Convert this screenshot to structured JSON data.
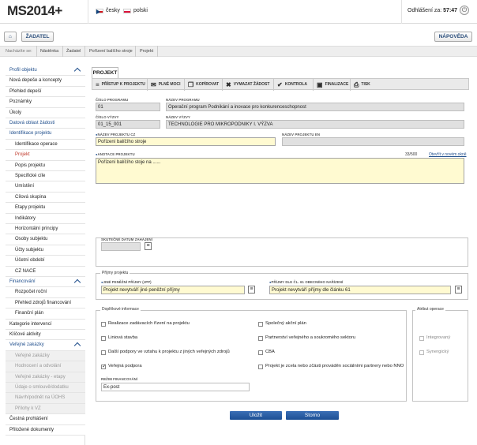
{
  "header": {
    "logo_main": "MS2014",
    "logo_plus": "+",
    "languages": [
      {
        "label": "česky",
        "flag": "cz"
      },
      {
        "label": "polski",
        "flag": "pl"
      }
    ],
    "logout_label": "Odhlášení za:",
    "logout_time": "57:47"
  },
  "nav": {
    "home_icon": "home-icon",
    "zadatel_label": "ŽADATEL",
    "napoveda_label": "NÁPOVĚDA"
  },
  "breadcrumb": {
    "prefix": "Nacházíte se:",
    "items": [
      "Nástěnka",
      "Žadatel",
      "Pořízení balíčho stroje",
      "Projekt"
    ]
  },
  "sidebar": {
    "items": [
      {
        "label": "Profil objektu",
        "type": "head"
      },
      {
        "label": "Nová depeše a koncepty",
        "type": "item"
      },
      {
        "label": "Přehled depeší",
        "type": "item"
      },
      {
        "label": "Poznámky",
        "type": "item"
      },
      {
        "label": "Úkoly",
        "type": "item"
      },
      {
        "label": "Datová oblast žádosti",
        "type": "head"
      },
      {
        "label": "Identifikace projektu",
        "type": "head"
      },
      {
        "label": "Identifikace operace",
        "type": "sub"
      },
      {
        "label": "Projekt",
        "type": "active"
      },
      {
        "label": "Popis projektu",
        "type": "sub"
      },
      {
        "label": "Specifické cíle",
        "type": "sub"
      },
      {
        "label": "Umístění",
        "type": "sub"
      },
      {
        "label": "Cílová skupina",
        "type": "sub"
      },
      {
        "label": "Etapy projektu",
        "type": "sub"
      },
      {
        "label": "Indikátory",
        "type": "sub"
      },
      {
        "label": "Horizontální principy",
        "type": "sub"
      },
      {
        "label": "Osoby subjektu",
        "type": "sub"
      },
      {
        "label": "Účty subjektu",
        "type": "sub"
      },
      {
        "label": "Účetní období",
        "type": "sub"
      },
      {
        "label": "CZ NACE",
        "type": "sub"
      },
      {
        "label": "Financování",
        "type": "head"
      },
      {
        "label": "Rozpočet roční",
        "type": "sub"
      },
      {
        "label": "Přehled zdrojů financování",
        "type": "sub"
      },
      {
        "label": "Finanční plán",
        "type": "sub"
      },
      {
        "label": "Kategorie intervencí",
        "type": "item"
      },
      {
        "label": "Klíčové aktivity",
        "type": "item"
      },
      {
        "label": "Veřejné zakázky",
        "type": "head"
      },
      {
        "label": "Veřejné zakázky",
        "type": "dis"
      },
      {
        "label": "Hodnocení a odvolání",
        "type": "dis"
      },
      {
        "label": "Veřejné zakázky - etapy",
        "type": "dis"
      },
      {
        "label": "Údaje o smlouvě/dodatku",
        "type": "dis"
      },
      {
        "label": "Návrh/podnět na ÚOHS",
        "type": "dis"
      },
      {
        "label": "Přílohy k VZ",
        "type": "dis"
      },
      {
        "label": "Čestná prohlášení",
        "type": "item"
      },
      {
        "label": "Přiložené dokumenty",
        "type": "item"
      }
    ]
  },
  "main": {
    "tab_label": "PROJEKT",
    "toolbar": [
      {
        "label": "PŘÍSTUP K PROJEKTU",
        "icon": "users-icon",
        "glyph": "≡"
      },
      {
        "label": "PLNÉ MOCI",
        "icon": "envelope-icon",
        "glyph": "✉"
      },
      {
        "label": "KOPÍROVAT",
        "icon": "copy-icon",
        "glyph": "❐"
      },
      {
        "label": "VYMAZAT ŽÁDOST",
        "icon": "delete-icon",
        "glyph": "✖"
      },
      {
        "label": "KONTROLA",
        "icon": "check-icon",
        "glyph": "✔"
      },
      {
        "label": "FINALIZACE",
        "icon": "lock-icon",
        "glyph": "▣"
      },
      {
        "label": "TISK",
        "icon": "print-icon",
        "glyph": "⎙"
      }
    ],
    "fields": {
      "cislo_programu_label": "ČÍSLO PROGRAMU",
      "cislo_programu": "01",
      "nazev_programu_label": "NÁZEV PROGRAMU",
      "nazev_programu": "Operační program Podnikání a inovace pro konkurenceschopnost",
      "cislo_vyzvy_label": "ČÍSLO VÝZVY",
      "cislo_vyzvy": "01_15_001",
      "nazev_vyzvy_label": "NÁZEV VÝZVY",
      "nazev_vyzvy": "TECHNOLOGIE PRO MIKROPODNIKY I. VÝZVA",
      "nazev_cz_label": "NÁZEV PROJEKTU CZ",
      "nazev_cz": "Pořízení balíčího stroje",
      "nazev_en_label": "NÁZEV PROJEKTU EN",
      "nazev_en": "",
      "anotace_label": "ANOTACE PROJEKTU",
      "anotace": "Pořízení balíčího stoje na ......",
      "counter": "33/500",
      "open_new": "Otevřít v novém okně",
      "datum_label": "SKUTEČNÉ DATUM ZAHÁJENÍ"
    },
    "prijmy": {
      "legend": "Příjmy projektu",
      "jpp_label": "JINÉ PENĚŽNÍ PŘÍJMY (JPP)",
      "jpp_value": "Projekt nevytváří jiné peněžní příjmy",
      "clanek_label": "PŘÍJMY DLE ČL. 61 OBECNÉHO NAŘÍZENÍ",
      "clanek_value": "Projekt nevytváří příjmy dle článku 61"
    },
    "doplnkove": {
      "legend": "Doplňkové informace",
      "left": [
        {
          "label": "Realizace zadávacích řízení na projektu",
          "checked": false
        },
        {
          "label": "Liniová stavba",
          "checked": false
        },
        {
          "label": "Další podpory ve vztahu k projektu z jiných veřejných zdrojů",
          "checked": false
        },
        {
          "label": "Veřejná podpora",
          "checked": true
        }
      ],
      "right": [
        {
          "label": "Společný akční plán",
          "checked": false
        },
        {
          "label": "Partnerství veřejného a soukromého sektoru",
          "checked": false
        },
        {
          "label": "CBA",
          "checked": false
        },
        {
          "label": "Projekt je zcela nebo zčásti prováděn sociálními partnery nebo NNO",
          "checked": false
        }
      ],
      "rezim_label": "REŽIM FINANCOVÁNÍ",
      "rezim_value": "Ex-post"
    },
    "atribut": {
      "legend": "Atribut operace",
      "items": [
        {
          "label": "Integrovaný",
          "checked": false
        },
        {
          "label": "Synergický",
          "checked": false
        }
      ]
    },
    "buttons": {
      "save": "Uložit",
      "cancel": "Storno"
    }
  }
}
